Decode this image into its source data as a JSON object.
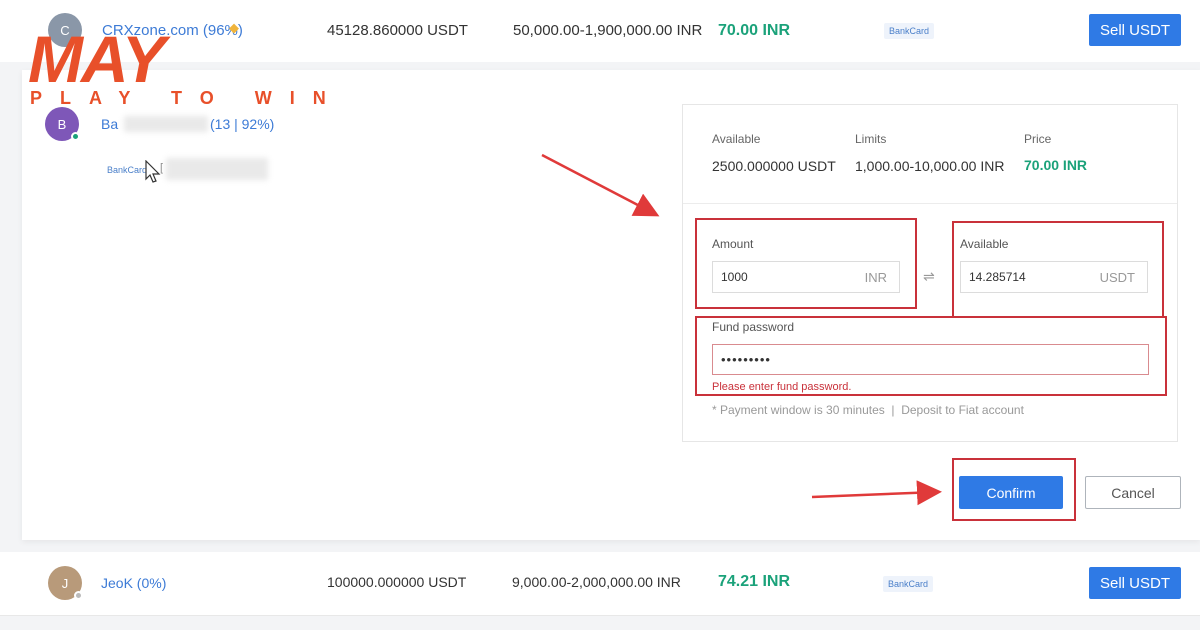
{
  "logo": {
    "text": "MAY",
    "tagline": "PLAY TO WIN"
  },
  "listings": [
    {
      "avatar_letter": "C",
      "avatar_color": "#8a97a8",
      "merchant": "CRXzone.com (96%)",
      "quantity": "45128.860000 USDT",
      "limits": "50,000.00-1,900,000.00 INR",
      "price": "70.00 INR",
      "payment": "BankCard",
      "action": "Sell USDT"
    },
    {
      "avatar_letter": "B",
      "avatar_color": "#7e57b8",
      "merchant_prefix": "Ba",
      "merchant_suffix": "(13 | 92%)",
      "payment": "BankCard",
      "payment_suffix": "["
    },
    {
      "avatar_letter": "J",
      "avatar_color": "#b89a7a",
      "merchant": "JeoK (0%)",
      "quantity": "100000.000000 USDT",
      "limits": "9,000.00-2,000,000.00 INR",
      "price": "74.21 INR",
      "payment": "BankCard",
      "action": "Sell USDT"
    }
  ],
  "order_panel": {
    "available_label": "Available",
    "available_value": "2500.000000 USDT",
    "limits_label": "Limits",
    "limits_value": "1,000.00-10,000.00 INR",
    "price_label": "Price",
    "price_value": "70.00 INR",
    "amount_label": "Amount",
    "amount_value": "1000",
    "amount_unit": "INR",
    "swap_symbol": "⇌",
    "receive_label": "Available",
    "receive_value": "14.285714",
    "receive_unit": "USDT",
    "password_label": "Fund password",
    "password_value": "•••••••••",
    "password_error": "Please enter fund password.",
    "note": "* Payment window is 30 minutes  |  Deposit to Fiat account",
    "confirm": "Confirm",
    "cancel": "Cancel"
  },
  "colors": {
    "accent": "#2f7ae5",
    "price_green": "#1ba27a",
    "highlight_red": "#c9313a",
    "logo_orange": "#e8502a"
  }
}
